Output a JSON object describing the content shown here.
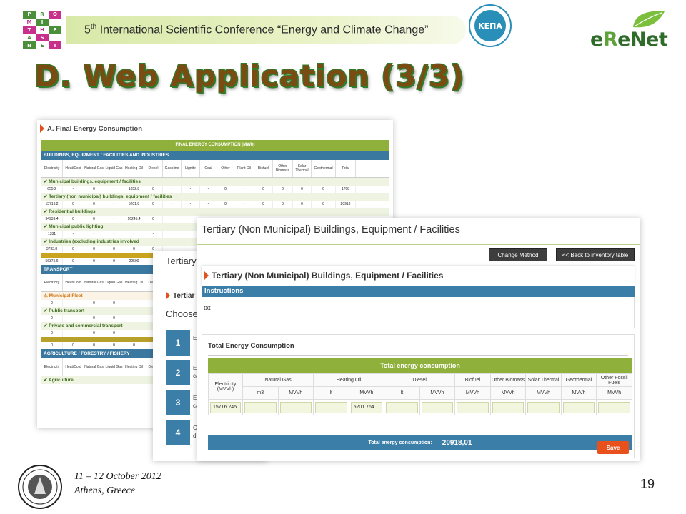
{
  "header": {
    "logo_letters": [
      "P",
      "R",
      "O",
      "M",
      "I",
      "",
      "T",
      "H",
      "E",
      "A",
      "S",
      "",
      "N",
      "E",
      "T"
    ],
    "conference_prefix": "5",
    "conference_sup": "th",
    "conference_rest": " International Scientific Conference “Energy and Climate Change”",
    "kepa_label": "ΚΕΠΑ",
    "erenet_e": "e",
    "erenet_r": "R",
    "erenet_rest": "eNet"
  },
  "slide": {
    "title": "D. Web Application (3/3)",
    "date": "11 – 12 October 2012",
    "place": "Athens, Greece",
    "page_number": "19"
  },
  "shot1": {
    "heading": "A. Final Energy Consumption",
    "banner": "FINAL ENERGY CONSUMPTION (MWh)",
    "section_buildings": "BUILDINGS, EQUIPMENT / FACILITIES AND INDUSTRIES",
    "col_headers": [
      "Electricity",
      "Heat/Cold",
      "Natural Gas",
      "Liquid Gas",
      "Heating Oil",
      "Diesel",
      "Gasoline",
      "Lignite",
      "Coal",
      "Other",
      "Plant Oil",
      "Biofuel",
      "Other Biomass",
      "Solar Thermal",
      "Geothermal",
      "Total"
    ],
    "fossil_label": "Fossil Fuels",
    "renewable_label": "Renewable Energies",
    "rows": [
      {
        "label": "Municipal buildings, equipment / facilities",
        "values": [
          "655.2",
          "-",
          "0",
          "-",
          "1052.8",
          "0",
          "-",
          "-",
          "-",
          "0",
          "-",
          "0",
          "0",
          "0",
          "0",
          "1708"
        ]
      },
      {
        "label": "Tertiary (non municipal) buildings, equipment / facilities",
        "values": [
          "15716.2",
          "0",
          "0",
          "-",
          "5201.8",
          "0",
          "-",
          "-",
          "-",
          "0",
          "-",
          "0",
          "0",
          "0",
          "0",
          "20918"
        ]
      },
      {
        "label": "Residential buildings",
        "values": [
          "34939.4",
          "0",
          "0",
          "-",
          "16245.4",
          "0"
        ]
      },
      {
        "label": "Municipal public lighting",
        "values": [
          "1331",
          "-",
          "-",
          "-",
          "-",
          "-"
        ]
      },
      {
        "label": "Industries (excluding industries involved",
        "values": [
          "3733.8",
          "0",
          "0",
          "0",
          "0",
          "0"
        ]
      },
      {
        "label": "",
        "values": [
          "56375.6",
          "0",
          "0",
          "0",
          "22500"
        ]
      }
    ],
    "section_transport": "TRANSPORT",
    "transport_rows": [
      {
        "label": "Municipal Fleet",
        "values": [
          "0",
          "-",
          "0",
          "0",
          "-"
        ]
      },
      {
        "label": "Public transport",
        "values": [
          "0",
          "-",
          "0",
          "0",
          "-"
        ]
      },
      {
        "label": "Private and commercial transport",
        "values": [
          "0",
          "-",
          "0",
          "0",
          "-"
        ]
      },
      {
        "label": "",
        "values": [
          "0",
          "0",
          "0",
          "0",
          "0"
        ]
      }
    ],
    "section_agri": "AGRICULTURE / FORESTRY / FISHERY",
    "agri_row": "Agriculture"
  },
  "shot2": {
    "title": "Tertiary",
    "sub": "Tertiar",
    "choose": "Choose",
    "steps": [
      {
        "num": "1",
        "text": "Ex"
      },
      {
        "num": "2",
        "text": "Ex\nca"
      },
      {
        "num": "3",
        "text": "Ex\nca"
      },
      {
        "num": "4",
        "text": "Co\ndi"
      }
    ]
  },
  "shot3": {
    "title": "Tertiary (Non Municipal) Buildings, Equipment / Facilities",
    "change_method": "Change Method",
    "back_button": "<< Back to inventory table",
    "sub_title": "Tertiary (Non Municipal) Buildings, Equipment / Facilities",
    "instructions_label": "Instructions",
    "instructions_text": "txt",
    "panel_title": "Total Energy Consumption",
    "green_header": "Total energy consumption",
    "columns": {
      "electricity": "Electricity (MVVh)",
      "natural_gas": "Natural Gas",
      "heating_oil": "Heating Oil",
      "diesel": "Diesel",
      "biofuel": "Biofuel",
      "other_biomass": "Other Biomass",
      "solar_thermal": "Solar Thermal",
      "geothermal": "Geothermal",
      "other_fossil": "Other Fossil Fuels"
    },
    "units": [
      "m3",
      "MVVh",
      "lt",
      "MVVh",
      "lt",
      "MVVh",
      "MVVh",
      "MVVh",
      "MVVh",
      "MVVh",
      "MVVh"
    ],
    "values": {
      "electricity": "15716.245",
      "heating_oil_mwh": "5201.764"
    },
    "total_label": "Total energy consumption:",
    "total_value": "20918,01",
    "save_label": "Save"
  }
}
